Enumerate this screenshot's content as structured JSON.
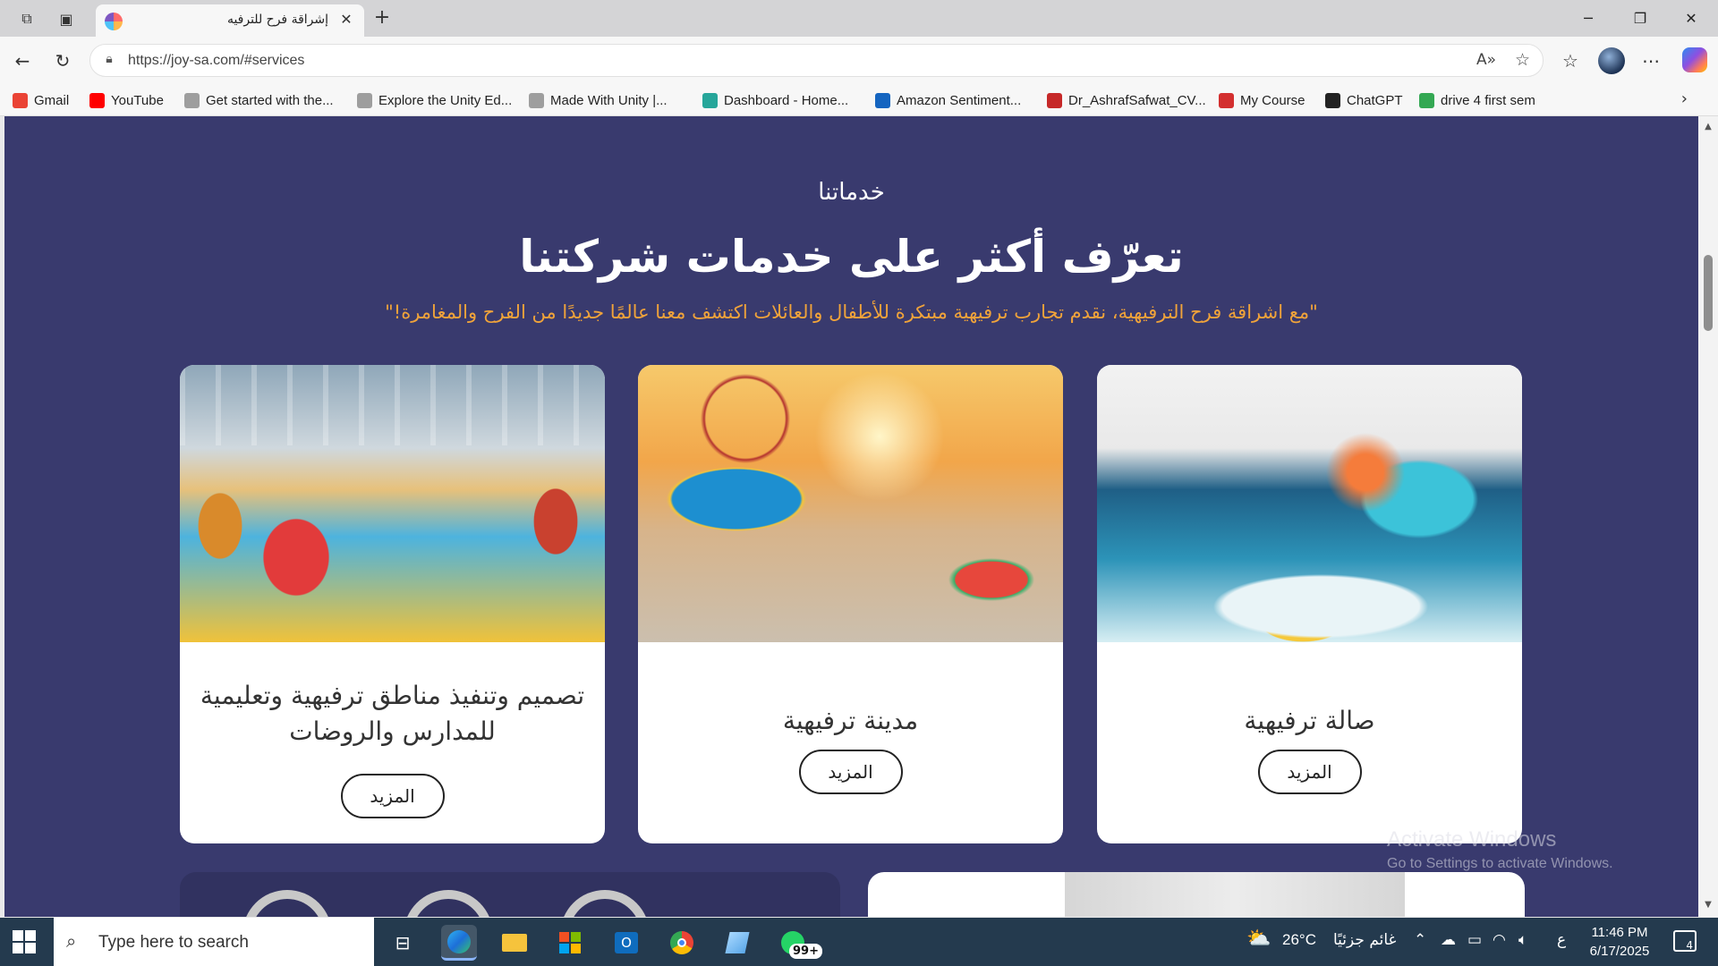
{
  "browser": {
    "tab_title": "إشراقة فرح للترفيه",
    "url": "https://joy-sa.com/#services",
    "read_aloud_icon": "read-aloud-icon",
    "new_tab_label": "+",
    "tab_close": "✕"
  },
  "bookmarks": [
    {
      "label": "Gmail",
      "color": "#ea4335"
    },
    {
      "label": "YouTube",
      "color": "#ff0000"
    },
    {
      "label": "Get started with the...",
      "color": "#9e9e9e"
    },
    {
      "label": "Explore the Unity Ed...",
      "color": "#9e9e9e"
    },
    {
      "label": "Made With Unity |...",
      "color": "#9e9e9e"
    },
    {
      "label": "Dashboard - Home...",
      "color": "#26a69a"
    },
    {
      "label": "Amazon Sentiment...",
      "color": "#1565c0"
    },
    {
      "label": "Dr_AshrafSafwat_CV...",
      "color": "#c62828"
    },
    {
      "label": "My Course",
      "color": "#d32f2f"
    },
    {
      "label": "ChatGPT",
      "color": "#222222"
    },
    {
      "label": "drive 4 first sem",
      "color": "#34a853"
    }
  ],
  "section": {
    "eyebrow": "خدماتنا",
    "heading": "تعرّف أكثر على خدمات شركتنا",
    "tagline": "\"مع اشراقة فرح الترفيهية، نقدم تجارب ترفيهية مبتكرة للأطفال والعائلات اكتشف معنا عالمًا جديدًا من الفرح والمغامرة!\""
  },
  "services": [
    {
      "title": "صالة ترفيهية",
      "button": "المزيد"
    },
    {
      "title": "مدينة ترفيهية",
      "button": "المزيد"
    },
    {
      "title": "تصميم وتنفيذ مناطق ترفيهية وتعليمية للمدارس والروضات",
      "button": "المزيد"
    }
  ],
  "watermark": {
    "line1": "Activate Windows",
    "line2": "Go to Settings to activate Windows."
  },
  "taskbar": {
    "search_placeholder": "Type here to search",
    "whatsapp_badge": "99+",
    "weather_temp": "26°C",
    "weather_desc": "غائم جزئيًا",
    "input_lang": "ع",
    "time": "11:46 PM",
    "date": "6/17/2025",
    "notification_count": "4"
  },
  "colors": {
    "page_bg": "#393a6e",
    "tagline": "#f0a33a",
    "whatsapp": "#25d366",
    "taskbar": "#243a4e"
  }
}
